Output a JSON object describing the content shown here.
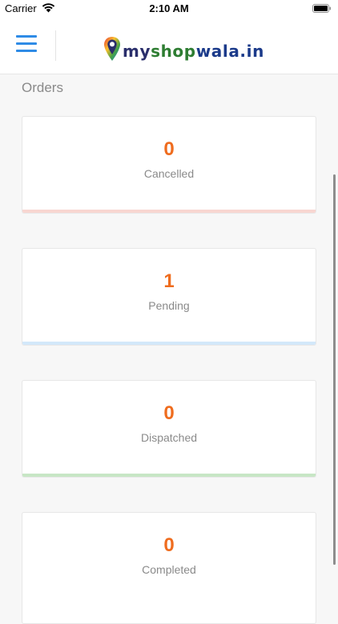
{
  "status_bar": {
    "carrier": "Carrier",
    "time": "2:10 AM",
    "wifi_icon": "wifi-icon",
    "battery_icon": "battery-icon"
  },
  "header": {
    "menu_icon": "hamburger-menu-icon",
    "logo": {
      "part1": "my",
      "part2": "shop",
      "part3": "wala.in",
      "colors": {
        "my": "#2a2e6b",
        "shop": "#2e7d32",
        "wala": "#1b3a8a"
      }
    }
  },
  "orders": {
    "title": "Orders",
    "cards": [
      {
        "count": "0",
        "label": "Cancelled",
        "bar_color": "#f8d6d1"
      },
      {
        "count": "1",
        "label": "Pending",
        "bar_color": "#d3e8fa"
      },
      {
        "count": "0",
        "label": "Dispatched",
        "bar_color": "#c7e6c5"
      },
      {
        "count": "0",
        "label": "Completed"
      }
    ],
    "count_color": "#ef6c1e"
  },
  "colors": {
    "accent": "#2e8be6",
    "background": "#f7f7f7"
  }
}
